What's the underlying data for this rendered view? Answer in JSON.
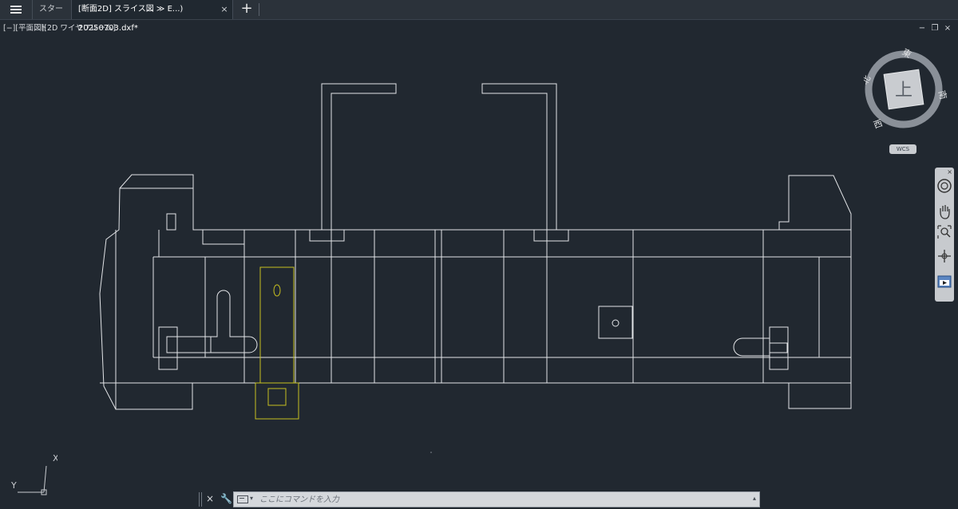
{
  "tabs": {
    "start_label": "スタート",
    "active_label": "[断面2D] スライス図 ≫ E...) 20250703.dxf*",
    "close_glyph": "×",
    "add_glyph": "+"
  },
  "viewport": {
    "label": "[−][平面図][2D ワイヤフレーム]",
    "controls": {
      "minimize": "−",
      "restore": "❐",
      "close": "×"
    }
  },
  "viewcube": {
    "face": "上",
    "north": "北",
    "east": "東",
    "south": "南",
    "west": "西",
    "wcs": "WCS"
  },
  "navbar": {
    "close_glyph": "×",
    "tools": [
      "steering-wheel-icon",
      "pan-icon",
      "zoom-extents-icon",
      "orbit-icon",
      "showmotion-icon"
    ]
  },
  "ucs": {
    "x_label": "X",
    "y_label": "Y"
  },
  "command": {
    "close_glyph": "×",
    "wrench_glyph": "🔧",
    "caret": "▾",
    "up_glyph": "▴",
    "placeholder": "ここにコマンドを入力"
  },
  "colors": {
    "background": "#212830",
    "geometry": "#e3e5e8",
    "highlight": "#c8c020"
  }
}
